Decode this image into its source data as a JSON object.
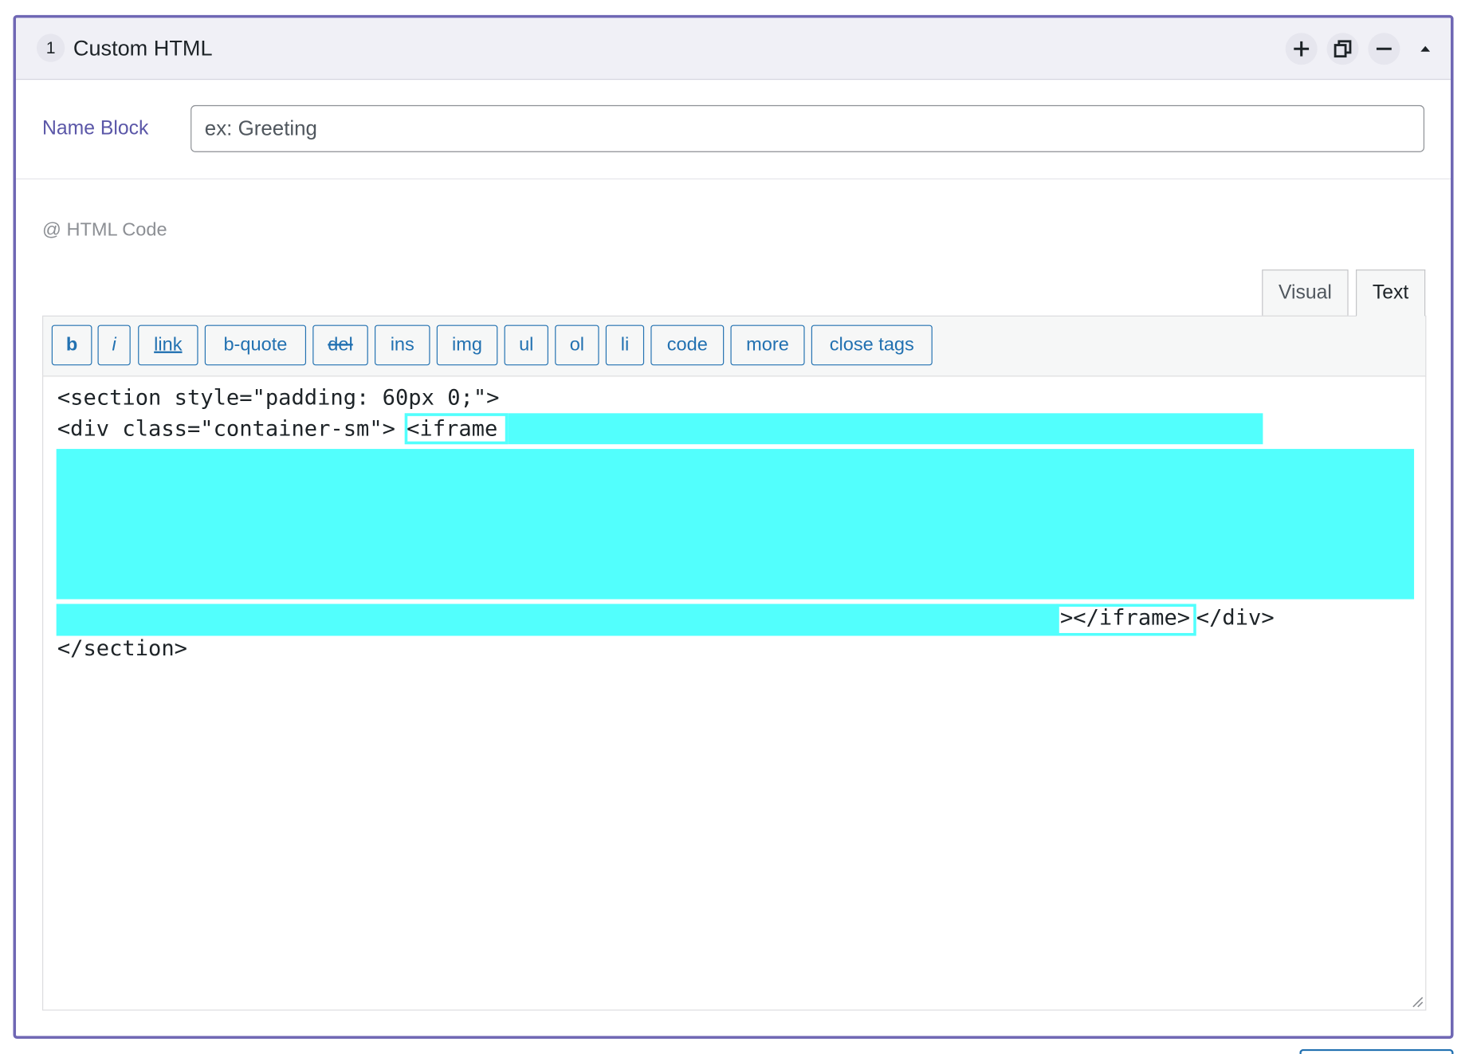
{
  "block": {
    "number": "1",
    "title": "Custom HTML",
    "actions": {
      "add_icon": "plus-icon",
      "duplicate_icon": "duplicate-icon",
      "remove_icon": "minus-icon",
      "collapse_icon": "caret-up-icon"
    }
  },
  "name_block": {
    "label": "Name Block",
    "placeholder": "ex: Greeting",
    "value": ""
  },
  "html_code": {
    "label": "@ HTML Code",
    "tabs": [
      {
        "label": "Visual",
        "active": false
      },
      {
        "label": "Text",
        "active": true
      }
    ],
    "quicktags": [
      "b",
      "i",
      "link",
      "b-quote",
      "del",
      "ins",
      "img",
      "ul",
      "ol",
      "li",
      "code",
      "more",
      "close tags"
    ],
    "code_lines": {
      "line1": "<section style=\"padding: 60px 0;\">",
      "line2_prefix": "<div class=\"container-sm\">",
      "line2_iframe_open": "<iframe ",
      "line4_iframe_close": "></iframe>",
      "line4_div_close": "</div>",
      "line5": "</section>"
    }
  },
  "colors": {
    "panel_border": "#6f67b4",
    "highlight": "#52fffd",
    "link_blue": "#2271b1",
    "label_purple": "#5b57a8"
  }
}
